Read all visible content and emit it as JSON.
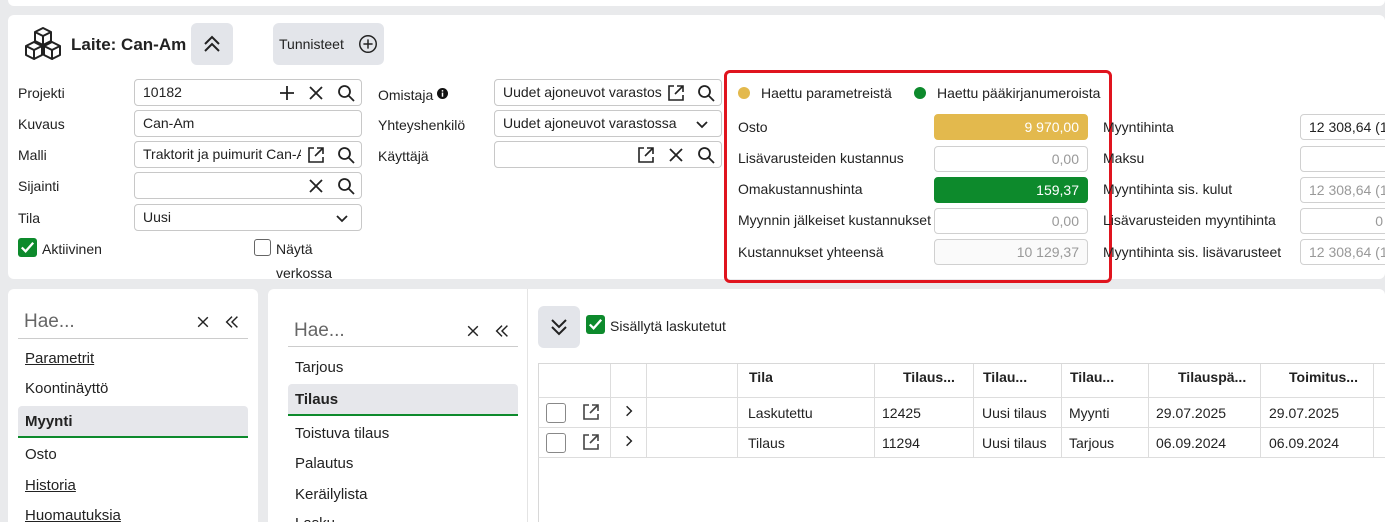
{
  "header": {
    "title": "Laite: Can-Am",
    "tags_label": "Tunnisteet"
  },
  "form": {
    "projekti_label": "Projekti",
    "projekti_value": "10182",
    "kuvaus_label": "Kuvaus",
    "kuvaus_value": "Can-Am",
    "malli_label": "Malli",
    "malli_value": "Traktorit ja puimurit Can-A",
    "sijainti_label": "Sijainti",
    "sijainti_value": "",
    "tila_label": "Tila",
    "tila_value": "Uusi",
    "aktiivinen_label": "Aktiivinen",
    "nayta_label_1": "Näytä",
    "nayta_label_2": "verkossa",
    "omistaja_label": "Omistaja",
    "omistaja_value": "Uudet ajoneuvot varastos",
    "yhteyshenkilo_label": "Yhteyshenkilö",
    "yhteyshenkilo_value": "Uudet ajoneuvot varastossa",
    "kayttaja_label": "Käyttäjä",
    "kayttaja_value": ""
  },
  "costs": {
    "legend_params": "Haettu parametreistä",
    "legend_ledger": "Haettu pääkirjanumeroista",
    "legend_params_color": "#e3b94d",
    "legend_ledger_color": "#0d8a2c",
    "rows": [
      {
        "label": "Osto",
        "value": "9 970,00"
      },
      {
        "label": "Lisävarusteiden kustannus",
        "value": "0,00"
      },
      {
        "label": "Omakustannushinta",
        "value": "159,37"
      },
      {
        "label": "Myynnin jälkeiset kustannukset",
        "value": "0,00"
      },
      {
        "label": "Kustannukset yhteensä",
        "value": "10 129,37"
      }
    ]
  },
  "sales": {
    "rows": [
      {
        "label": "Myyntihinta",
        "value": "12 308,64 (1"
      },
      {
        "label": "Maksu",
        "value": ""
      },
      {
        "label": "Myyntihinta sis. kulut",
        "value": "12 308,64 (1"
      },
      {
        "label": "Lisävarusteiden myyntihinta",
        "value": "0"
      },
      {
        "label": "Myyntihinta sis. lisävarusteet",
        "value": "12 308,64 (1"
      }
    ]
  },
  "left_nav": {
    "search_placeholder": "Hae...",
    "items": [
      {
        "label": "Parametrit"
      },
      {
        "label": "Koontinäyttö"
      },
      {
        "label": "Myynti"
      },
      {
        "label": "Osto"
      },
      {
        "label": "Historia"
      },
      {
        "label": "Huomautuksia"
      }
    ]
  },
  "mid_nav": {
    "search_placeholder": "Hae...",
    "items": [
      {
        "label": "Tarjous"
      },
      {
        "label": "Tilaus"
      },
      {
        "label": "Toistuva tilaus"
      },
      {
        "label": "Palautus"
      },
      {
        "label": "Keräilylista"
      },
      {
        "label": "Lasku"
      }
    ]
  },
  "grid": {
    "include_invoiced_label": "Sisällytä laskutetut",
    "columns": [
      "Tila",
      "Tilaus...",
      "Tilau...",
      "Tilau...",
      "Tilauspä...",
      "Toimitus..."
    ],
    "rows": [
      [
        "Laskutettu",
        "12425",
        "Uusi tilaus",
        "Myynti",
        "29.07.2025",
        "29.07.2025"
      ],
      [
        "Tilaus",
        "11294",
        "Uusi tilaus",
        "Tarjous",
        "06.09.2024",
        "06.09.2024"
      ]
    ]
  }
}
